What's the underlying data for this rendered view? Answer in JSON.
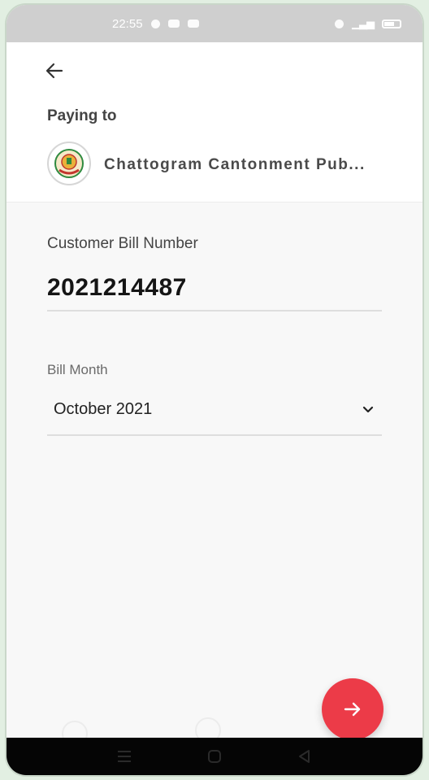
{
  "status_bar": {
    "time": "22:55",
    "icons": [
      "notification-icon",
      "mail-icon",
      "share-icon",
      "alarm-icon",
      "signal-icon",
      "battery-icon"
    ]
  },
  "header": {
    "back_icon": "arrow-left-icon",
    "paying_label": "Paying to",
    "merchant_name": "Chattogram Cantonment Pub..."
  },
  "form": {
    "bill_number_label": "Customer Bill Number",
    "bill_number_value": "2021214487",
    "bill_month_label": "Bill Month",
    "bill_month_value": "October 2021"
  },
  "fab": {
    "icon": "arrow-right-icon",
    "color": "#ec3b48"
  },
  "nav_bar": {
    "icons": [
      "menu-icon",
      "home-icon",
      "back-triangle-icon"
    ]
  }
}
